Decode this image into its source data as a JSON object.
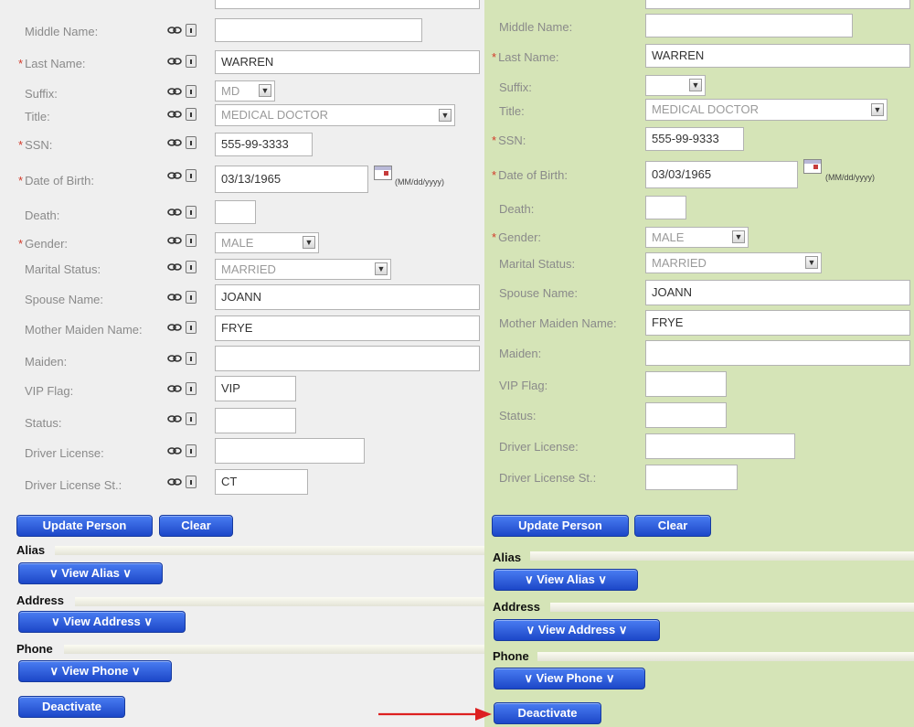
{
  "format_hint": "(MM/dd/yyyy)",
  "left": {
    "labels": {
      "middle_name": "Middle Name:",
      "last_name": "Last Name:",
      "suffix": "Suffix:",
      "title": "Title:",
      "ssn": "SSN:",
      "dob": "Date of Birth:",
      "death": "Death:",
      "gender": "Gender:",
      "marital": "Marital Status:",
      "spouse": "Spouse Name:",
      "mother": "Mother Maiden Name:",
      "maiden": "Maiden:",
      "vip": "VIP Flag:",
      "status": "Status:",
      "driver": "Driver License:",
      "driver_st": "Driver License St.:"
    },
    "values": {
      "last_name": "WARREN",
      "suffix": "MD",
      "title": "MEDICAL DOCTOR",
      "ssn": "555-99-3333",
      "dob": "03/13/1965",
      "gender": "MALE",
      "marital": "MARRIED",
      "spouse": "JOANN",
      "mother": "FRYE",
      "vip": "VIP",
      "driver_st": "CT"
    },
    "buttons": {
      "update": "Update Person",
      "clear": "Clear",
      "view_alias": "View  Alias",
      "view_address": "View  Address",
      "view_phone": "View  Phone",
      "deactivate": "Deactivate"
    },
    "sections": {
      "alias": "Alias",
      "address": "Address",
      "phone": "Phone"
    }
  },
  "right": {
    "labels": {
      "middle_name": "Middle Name:",
      "last_name": "Last Name:",
      "suffix": "Suffix:",
      "title": "Title:",
      "ssn": "SSN:",
      "dob": "Date of Birth:",
      "death": "Death:",
      "gender": "Gender:",
      "marital": "Marital Status:",
      "spouse": "Spouse Name:",
      "mother": "Mother Maiden Name:",
      "maiden": "Maiden:",
      "vip": "VIP Flag:",
      "status": "Status:",
      "driver": "Driver License:",
      "driver_st": "Driver License St.:"
    },
    "values": {
      "last_name": "WARREN",
      "title": "MEDICAL DOCTOR",
      "ssn": "555-99-9333",
      "dob": "03/03/1965",
      "gender": "MALE",
      "marital": "MARRIED",
      "spouse": "JOANN",
      "mother": "FRYE"
    },
    "buttons": {
      "update": "Update Person",
      "clear": "Clear",
      "view_alias": "View Alias",
      "view_address": "View Address",
      "view_phone": "View Phone",
      "deactivate": "Deactivate"
    },
    "sections": {
      "alias": "Alias",
      "address": "Address",
      "phone": "Phone"
    }
  },
  "colors": {
    "left_bg": "#efefef",
    "right_bg": "#d5e4b7",
    "button": "#2a5ad8",
    "arrow": "#dd2020",
    "required": "#d23a2a"
  }
}
